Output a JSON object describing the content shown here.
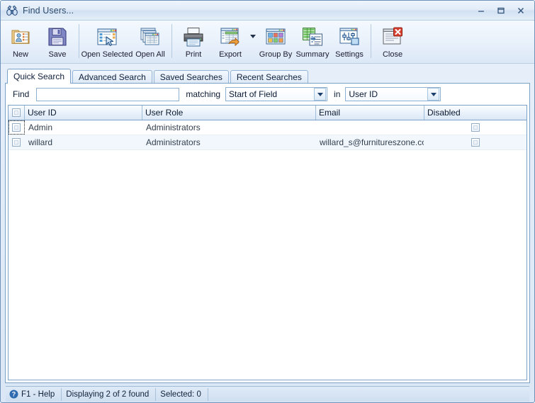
{
  "window": {
    "title": "Find Users...",
    "title_icon": "binoculars-icon",
    "minimize_label": "Minimize",
    "maximize_label": "Maximize",
    "close_label": "Close"
  },
  "toolbar": {
    "items": [
      {
        "label": "New",
        "icon": "new-user-card-icon",
        "name": "new-button",
        "wide": false,
        "sep_after": false,
        "arrow": false
      },
      {
        "label": "Save",
        "icon": "floppy-disk-icon",
        "name": "save-button",
        "wide": false,
        "sep_after": true,
        "arrow": false
      },
      {
        "label": "Open Selected",
        "icon": "open-selected-icon",
        "name": "open-selected-button",
        "wide": true,
        "sep_after": false,
        "arrow": false
      },
      {
        "label": "Open All",
        "icon": "open-all-icon",
        "name": "open-all-button",
        "wide": false,
        "sep_after": true,
        "arrow": false
      },
      {
        "label": "Print",
        "icon": "printer-icon",
        "name": "print-button",
        "wide": false,
        "sep_after": false,
        "arrow": false
      },
      {
        "label": "Export",
        "icon": "export-icon",
        "name": "export-button",
        "wide": false,
        "sep_after": false,
        "arrow": true
      },
      {
        "label": "Group By",
        "icon": "group-by-icon",
        "name": "group-by-button",
        "wide": false,
        "sep_after": false,
        "arrow": false
      },
      {
        "label": "Summary",
        "icon": "summary-icon",
        "name": "summary-button",
        "wide": false,
        "sep_after": false,
        "arrow": false
      },
      {
        "label": "Settings",
        "icon": "settings-icon",
        "name": "settings-button",
        "wide": false,
        "sep_after": true,
        "arrow": false
      },
      {
        "label": "Close",
        "icon": "close-window-icon",
        "name": "close-button",
        "wide": false,
        "sep_after": false,
        "arrow": false
      }
    ]
  },
  "tabs": [
    {
      "label": "Quick Search",
      "active": true
    },
    {
      "label": "Advanced Search",
      "active": false
    },
    {
      "label": "Saved Searches",
      "active": false
    },
    {
      "label": "Recent Searches",
      "active": false
    }
  ],
  "search": {
    "find_label": "Find",
    "find_value": "",
    "find_placeholder": "",
    "matching_label": "matching",
    "match_mode": "Start of Field",
    "in_label": "in",
    "field": "User ID"
  },
  "grid": {
    "columns": [
      {
        "key": "select",
        "label": "",
        "type": "checkbox"
      },
      {
        "key": "userid",
        "label": "User ID",
        "type": "text"
      },
      {
        "key": "role",
        "label": "User Role",
        "type": "text"
      },
      {
        "key": "email",
        "label": "Email",
        "type": "text"
      },
      {
        "key": "disabled",
        "label": "Disabled",
        "type": "checkbox"
      }
    ],
    "rows": [
      {
        "selected": false,
        "userid": "Admin",
        "role": "Administrators",
        "email": "",
        "disabled": false,
        "focused": true
      },
      {
        "selected": false,
        "userid": "willard",
        "role": "Administrators",
        "email": "willard_s@furnitureszone.com",
        "disabled": false,
        "focused": false
      }
    ]
  },
  "statusbar": {
    "help": "F1 - Help",
    "help_icon": "help-circle-icon",
    "displaying": "Displaying 2 of 2 found",
    "selected": "Selected: 0"
  },
  "colors": {
    "frame_border": "#6f92ba",
    "title_text": "#2b4a6b",
    "tab_border": "#7aa2c8",
    "grid_header_border": "#7ba3c9",
    "alt_row": "#f2f7fd",
    "status_bg": "#cfdff1"
  }
}
